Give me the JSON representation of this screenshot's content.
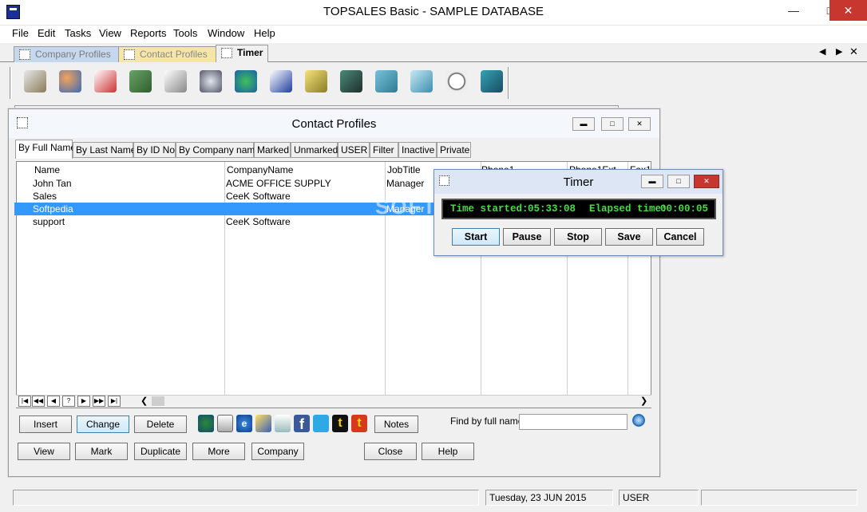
{
  "window": {
    "title": "TOPSALES Basic - SAMPLE DATABASE"
  },
  "menu": [
    "File",
    "Edit",
    "Tasks",
    "View",
    "Reports",
    "Tools",
    "Window",
    "Help"
  ],
  "mdi_tabs": [
    "Company Profiles",
    "Contact Profiles",
    "Timer"
  ],
  "contact_window": {
    "title": "Contact Profiles",
    "tabs": [
      "By Full Name",
      "By Last Name",
      "By ID No",
      "By Company name",
      "Marked",
      "Unmarked",
      "USER",
      "Filter",
      "Inactive",
      "Private"
    ],
    "columns": [
      "Name",
      "CompanyName",
      "JobTitle",
      "Phone1",
      "Phone1Ext",
      "Fax1"
    ],
    "rows": [
      [
        "John Tan",
        "ACME OFFICE SUPPLY",
        "Manager"
      ],
      [
        "Sales",
        "CeeK Software",
        ""
      ],
      [
        "Softpedia",
        "",
        "Manager"
      ],
      [
        "support",
        "CeeK Software",
        ""
      ]
    ],
    "buttons_row1": {
      "insert": "Insert",
      "change": "Change",
      "delete": "Delete",
      "notes": "Notes"
    },
    "find_label": "Find by full name:",
    "find_value": "",
    "buttons_row2": {
      "view": "View",
      "mark": "Mark",
      "duplicate": "Duplicate",
      "more": "More",
      "company": "Company",
      "close": "Close",
      "help": "Help"
    }
  },
  "timer": {
    "title": "Timer",
    "time_started_label": "Time started:",
    "time_started": "05:33:08",
    "elapsed_label": "Elapsed time:",
    "elapsed": "00:00:05",
    "buttons": {
      "start": "Start",
      "pause": "Pause",
      "stop": "Stop",
      "save": "Save",
      "cancel": "Cancel"
    }
  },
  "statusbar": {
    "date": "Tuesday, 23 JUN 2015",
    "user": "USER"
  },
  "watermark": "SOFTPEDIA"
}
